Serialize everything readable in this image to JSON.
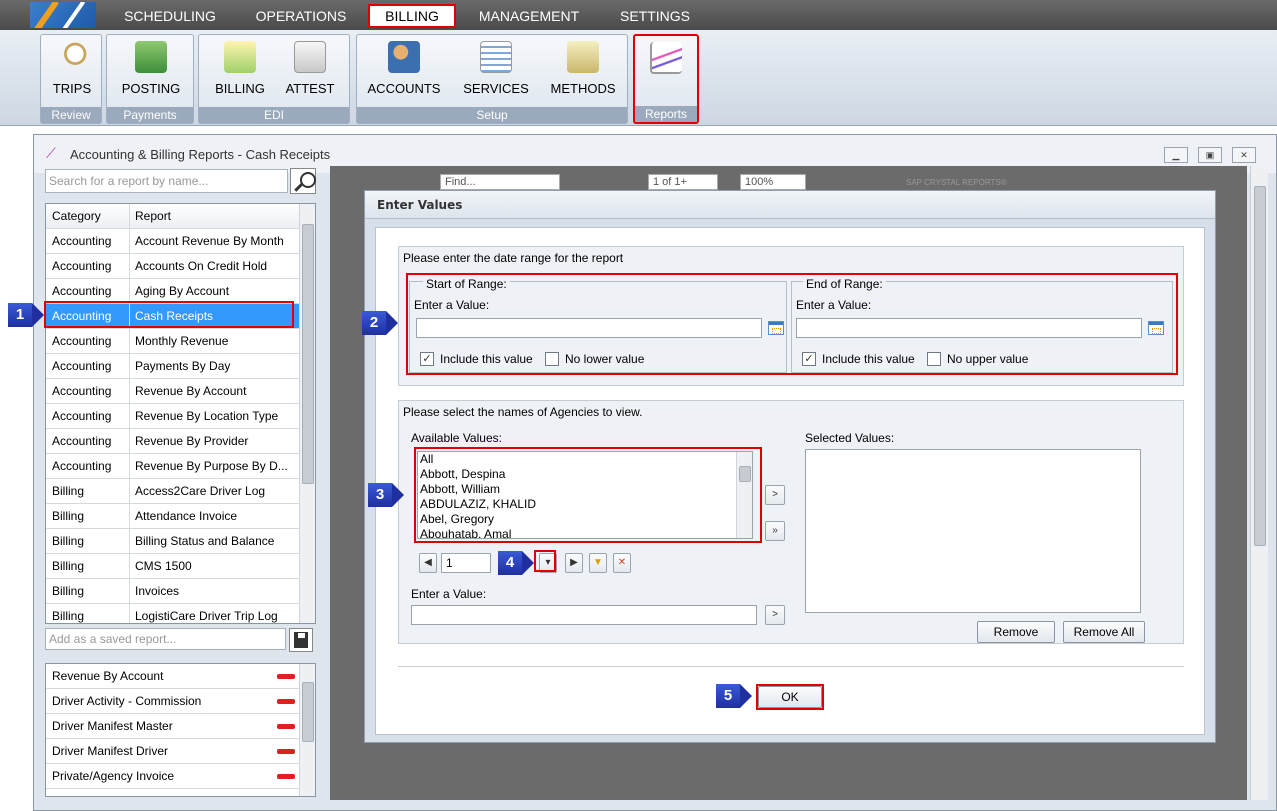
{
  "menu": {
    "items": [
      {
        "label": "SCHEDULING"
      },
      {
        "label": "OPERATIONS"
      },
      {
        "label": "BILLING",
        "active": true
      },
      {
        "label": "MANAGEMENT"
      },
      {
        "label": "SETTINGS"
      }
    ]
  },
  "ribbon": {
    "groups": [
      {
        "title": "Review",
        "buttons": [
          {
            "label": "TRIPS",
            "icon": "magnifier-icon"
          }
        ]
      },
      {
        "title": "Payments",
        "buttons": [
          {
            "label": "POSTING",
            "icon": "money-icon"
          }
        ]
      },
      {
        "title": "EDI",
        "buttons": [
          {
            "label": "BILLING",
            "icon": "download-icon"
          },
          {
            "label": "ATTEST",
            "icon": "document-icon"
          }
        ]
      },
      {
        "title": "Setup",
        "buttons": [
          {
            "label": "ACCOUNTS",
            "icon": "users-icon"
          },
          {
            "label": "SERVICES",
            "icon": "list-icon"
          },
          {
            "label": "METHODS",
            "icon": "cash-icon"
          }
        ]
      },
      {
        "title": "Reports",
        "buttons": [
          {
            "label": "",
            "icon": "chart-icon"
          }
        ]
      }
    ]
  },
  "window": {
    "title": "Accounting & Billing Reports - Cash Receipts",
    "search_placeholder": "Search for a report by name...",
    "grid": {
      "headers": [
        "Category",
        "Report"
      ],
      "rows": [
        {
          "category": "Accounting",
          "report": "Account Revenue By Month"
        },
        {
          "category": "Accounting",
          "report": "Accounts On Credit Hold"
        },
        {
          "category": "Accounting",
          "report": "Aging By Account"
        },
        {
          "category": "Accounting",
          "report": "Cash Receipts",
          "selected": true
        },
        {
          "category": "Accounting",
          "report": "Monthly Revenue"
        },
        {
          "category": "Accounting",
          "report": "Payments By Day"
        },
        {
          "category": "Accounting",
          "report": "Revenue By Account"
        },
        {
          "category": "Accounting",
          "report": "Revenue By Location Type"
        },
        {
          "category": "Accounting",
          "report": "Revenue By Provider"
        },
        {
          "category": "Accounting",
          "report": "Revenue By Purpose By D..."
        },
        {
          "category": "Billing",
          "report": "Access2Care Driver Log"
        },
        {
          "category": "Billing",
          "report": "Attendance Invoice"
        },
        {
          "category": "Billing",
          "report": "Billing Status and Balance"
        },
        {
          "category": "Billing",
          "report": "CMS 1500"
        },
        {
          "category": "Billing",
          "report": "Invoices"
        },
        {
          "category": "Billing",
          "report": "LogistiCare Driver Trip Log"
        }
      ]
    },
    "saved_placeholder": "Add as a saved report...",
    "saved_reports": [
      "Revenue By Account",
      "Driver Activity - Commission",
      "Driver Manifest Master",
      "Driver Manifest Driver",
      "Private/Agency Invoice"
    ]
  },
  "viewer_toolbar": {
    "find": "Find...",
    "page": "1 of 1+",
    "zoom": "100%",
    "brand": "SAP CRYSTAL REPORTS®"
  },
  "dialog": {
    "title": "Enter Values",
    "date_prompt": "Please enter the date range for the report",
    "start": {
      "legend": "Start of Range:",
      "enter_label": "Enter a Value:",
      "value": "",
      "include": "Include this value",
      "no_bound": "No lower value",
      "include_checked": true,
      "no_bound_checked": false
    },
    "end": {
      "legend": "End of Range:",
      "enter_label": "Enter a Value:",
      "value": "",
      "include": "Include this value",
      "no_bound": "No upper value",
      "include_checked": true,
      "no_bound_checked": false
    },
    "agencies_prompt": "Please select the names of Agencies to view.",
    "available_label": "Available Values:",
    "available": [
      "All",
      "Abbott, Despina",
      "Abbott, William",
      "ABDULAZIZ, KHALID",
      "Abel, Gregory",
      "Abouhatab, Amal"
    ],
    "selected_label": "Selected Values:",
    "page_value": "1",
    "enter_value_label": "Enter a Value:",
    "remove_label": "Remove",
    "remove_all_label": "Remove All",
    "ok_label": "OK"
  },
  "callouts": [
    "1",
    "2",
    "3",
    "4",
    "5"
  ],
  "colors": {
    "highlight": "#e00000",
    "selection": "#3399ff",
    "callout": "#1f2fa0"
  }
}
